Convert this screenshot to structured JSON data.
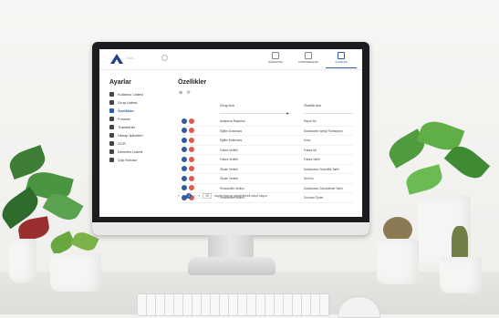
{
  "search": {
    "placeholder": "Ara..."
  },
  "topnav": [
    {
      "label": "ANASAYFA",
      "icon": "home-icon"
    },
    {
      "label": "DOKÜMANLAR",
      "icon": "document-icon"
    },
    {
      "label": "AYARLAR",
      "icon": "settings-icon",
      "active": true
    }
  ],
  "sidebar": {
    "title": "Ayarlar",
    "items": [
      {
        "label": "Kullanıcı Listesi"
      },
      {
        "label": "Grup Listesi"
      },
      {
        "label": "Özellikler",
        "active": true
      },
      {
        "label": "Formlar"
      },
      {
        "label": "Transferler"
      },
      {
        "label": "Hesap İşlemleri"
      },
      {
        "label": "OCR"
      },
      {
        "label": "Denetim Listesi"
      },
      {
        "label": "Çöp Kutusu"
      }
    ]
  },
  "main": {
    "title": "Özellikler",
    "columns": [
      "Grup Adı",
      "Özellik Adı"
    ],
    "rows": [
      [
        "Araştırma Raporları",
        "Rapor No"
      ],
      [
        "Eğitim Dokümanı",
        "Dokümanın İçeriği Fonksiyonu"
      ],
      [
        "Eğitim Dokümanı",
        "Konu"
      ],
      [
        "Fatura Verileri",
        "Fatura No"
      ],
      [
        "Fatura Verileri",
        "Fatura Tarihi"
      ],
      [
        "Ölçüm Verileri",
        "Dokümanın Geçerlilik Tarihi"
      ],
      [
        "Ölçüm Verileri",
        "Seri No"
      ],
      [
        "Personeller Verileri",
        "Dokümanın Güncelleme Tarihi"
      ],
      [
        "Personeller Verileri",
        "Sorumlu Tipleri"
      ]
    ],
    "pager": {
      "current": "1",
      "page_size": "10",
      "info": "sayfa başına gösterilecek kayıt sayısı"
    }
  }
}
